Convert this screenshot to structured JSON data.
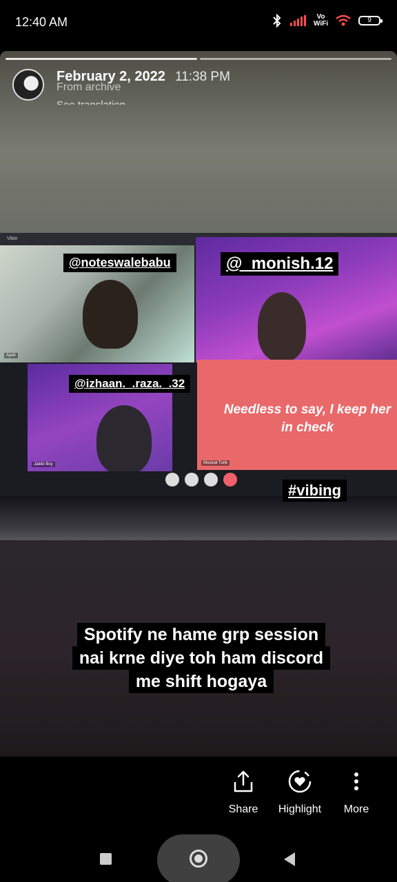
{
  "status_bar": {
    "time": "12:40 AM",
    "vowifi_top": "Vo",
    "vowifi_bottom": "WiFi",
    "battery": "9",
    "icons": [
      "bluetooth-icon",
      "signal-icon",
      "wifi-icon",
      "battery-icon"
    ]
  },
  "story": {
    "date": "February 2, 2022",
    "time": "11:38 PM",
    "archive_label": "From archive",
    "see_translation": "See translation",
    "photo": {
      "app_name": "Vibin",
      "quote": "Needless to say, I keep her in check",
      "tile_labels": [
        "Ayub",
        "Jalebi Boy",
        "Musical Tunk"
      ]
    },
    "stickers": [
      "@noteswalebabu",
      "@_monish.12",
      "@izhaan._.raza._.32",
      "#vibing"
    ],
    "caption_lines": [
      "Spotify ne hame grp session",
      "nai krne diye toh ham discord",
      "me shift hogaya"
    ]
  },
  "actions": {
    "share": "Share",
    "highlight": "Highlight",
    "more": "More"
  }
}
